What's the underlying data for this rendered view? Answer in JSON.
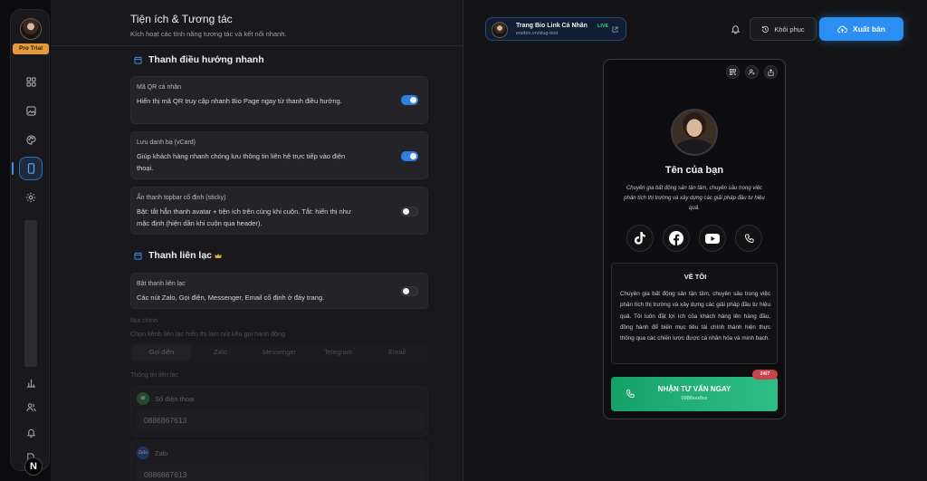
{
  "sidebar": {
    "plan_badge": "Pro Trial",
    "logo_letter": "N",
    "icons": [
      "grid-icon",
      "image-icon",
      "palette-icon",
      "phone-icon",
      "gear-icon",
      "bar-chart-icon",
      "users-icon",
      "bell-icon",
      "file-icon"
    ]
  },
  "header": {
    "title": "Tiện ích & Tương tác",
    "subtitle": "Kích hoạt các tính năng tương tác và kết nối nhanh."
  },
  "quick_nav": {
    "title": "Thanh điều hướng nhanh",
    "items": [
      {
        "label": "Mã QR cá nhân",
        "desc": "Hiển thị mã QR truy cập nhanh Bio Page ngay từ thanh điều hướng.",
        "enabled": true
      },
      {
        "label": "Lưu danh bạ (vCard)",
        "desc": "Giúp khách hàng nhanh chóng lưu thông tin liên hệ trực tiếp vào điện thoại.",
        "enabled": true
      },
      {
        "label": "Ẩn thanh topbar cố định (sticky)",
        "desc": "Bật: tắt hẳn thanh avatar + tiện ích trên cùng khi cuộn. Tắt: hiển thị như mặc định (hiện dần khi cuộn qua header).",
        "enabled": false
      }
    ]
  },
  "contact_bar": {
    "title": "Thanh liên lạc",
    "toggle_label": "Bật thanh liên lạc",
    "toggle_desc": "Các nút Zalo, Gọi điện, Messenger, Email cố định ở đáy trang.",
    "enabled": false,
    "main_button_label": "Nút chính",
    "main_button_desc": "Chọn kênh liên lạc hiển thị làm nút kêu gọi hành động",
    "tabs": [
      "Gọi điện",
      "Zalo",
      "Messenger",
      "Telegram",
      "Email"
    ],
    "active_tab": "Gọi điện",
    "info_label": "Thông tin liên lạc",
    "fields": [
      {
        "label": "Số điện thoại",
        "value": "0886867613",
        "icon_text": "☎",
        "color": "#2e9a55"
      },
      {
        "label": "Zalo",
        "value": "0886867613",
        "icon_text": "Zalo",
        "color": "#2463d6"
      }
    ]
  },
  "topbar": {
    "site_name": "Trang Bio Link Cá Nhân",
    "live_label": "LIVE",
    "site_url": "enebio.vn/slug-test",
    "restore_label": "Khôi phục",
    "publish_label": "Xuất bản"
  },
  "preview": {
    "name": "Tên của bạn",
    "bio": "Chuyên gia bất động sản tận tâm, chuyên sâu trong việc phân tích thị trường và xây dựng các giải pháp đầu tư hiệu quả.",
    "socials": [
      "tiktok-icon",
      "facebook-icon",
      "youtube-icon",
      "phone-icon"
    ],
    "about_title": "VỀ TÔI",
    "about_text": "Chuyên gia bất động sản tận tâm, chuyên sâu trong việc phân tích thị trường và xây dựng các giải pháp đầu tư hiệu quả. Tôi luôn đặt lợi ích của khách hàng lên hàng đầu, đồng hành để biến mục tiêu tài chính thành hiện thực thông qua các chiến lược được cá nhân hóa và minh bạch.",
    "cta_title": "NHẬN TƯ VẤN NGAY",
    "cta_sub": "0988xxx8xx",
    "cta_badge": "24/7"
  },
  "colors": {
    "accent": "#2b8ef2",
    "success": "#2fbf86",
    "danger": "#c9414a",
    "pro": "#e59a3a"
  }
}
